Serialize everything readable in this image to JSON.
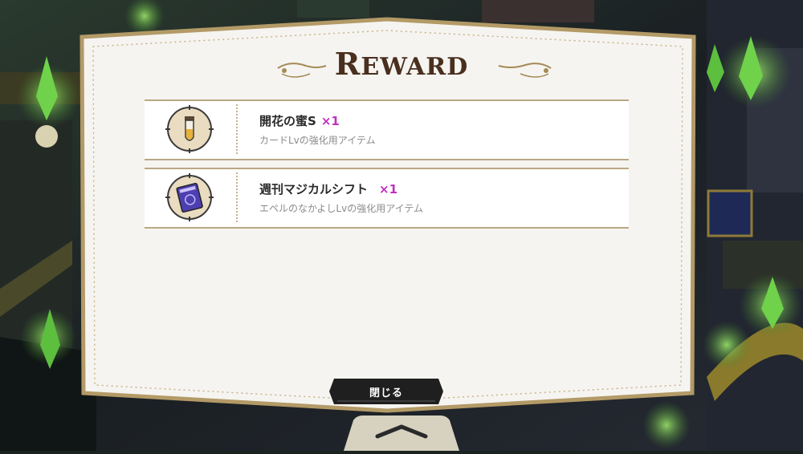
{
  "dialog": {
    "title_first": "R",
    "title_rest": "EWARD"
  },
  "rewards": [
    {
      "name": "開花の蜜S",
      "qty": "×1",
      "desc": "カードLvの強化用アイテム",
      "icon": "nectar-vial-icon"
    },
    {
      "name": "週刊マジカルシフト",
      "qty": "×1",
      "desc": "エペルのなかよしLvの強化用アイテム",
      "icon": "magazine-icon"
    }
  ],
  "buttons": {
    "close_label": "閉じる"
  },
  "colors": {
    "qty_accent": "#c02fbf",
    "frame_border": "#b39a66",
    "card_bg": "#f5f4f1"
  }
}
